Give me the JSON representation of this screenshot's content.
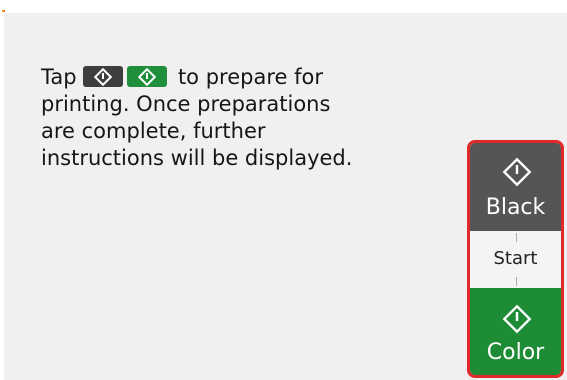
{
  "message": {
    "line1_before": "Tap",
    "line1_after": "to prepare for",
    "line2": "printing. Once preparations",
    "line3": "are complete, further",
    "line4": "instructions will be displayed."
  },
  "buttons": {
    "black_label": "Black",
    "start_label": "Start",
    "color_label": "Color"
  },
  "colors": {
    "black_button": "#555555",
    "color_button": "#1e8c35",
    "highlight_border": "#e02a2a"
  },
  "icons": {
    "start_icon": "diamond-start-icon"
  }
}
